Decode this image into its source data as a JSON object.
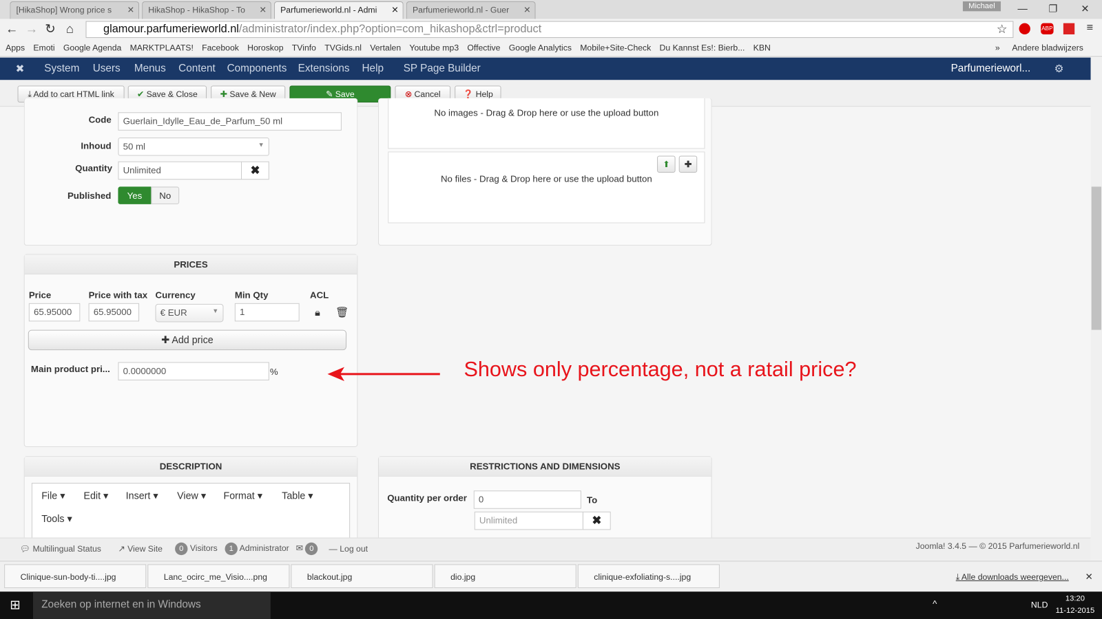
{
  "browser": {
    "tabs": [
      "[HikaShop] Wrong price s",
      "HikaShop - HikaShop - To",
      "Parfumerieworld.nl - Admi",
      "Parfumerieworld.nl - Guer"
    ],
    "user": "Michael",
    "url_domain": "glamour.parfumerieworld.nl",
    "url_path": "/administrator/index.php?option=com_hikashop&ctrl=product",
    "bookmarks": [
      "Apps",
      "Emoti",
      "Google Agenda",
      "MARKTPLAATS!",
      "Facebook",
      "Horoskop",
      "TVinfo",
      "TVGids.nl",
      "Vertalen",
      "Youtube mp3",
      "Offective",
      "Google Analytics",
      "Mobile+Site-Check",
      "Du Kannst Es!: Bierb...",
      "KBN"
    ],
    "more": "»",
    "other_bookmarks": "Andere bladwijzers"
  },
  "nav": {
    "items": [
      "System",
      "Users",
      "Menus",
      "Content",
      "Components",
      "Extensions",
      "Help",
      "SP Page Builder"
    ],
    "site": "Parfumerieworl..."
  },
  "toolbar": {
    "add_cart": "Add to cart HTML link",
    "save_close": "Save & Close",
    "save_new": "Save & New",
    "save": "Save",
    "cancel": "Cancel",
    "help": "Help",
    "save_color": "#2f8a2f"
  },
  "general": {
    "code_label": "Code",
    "code": "Guerlain_Idylle_Eau_de_Parfum_50 ml",
    "inhoud_label": "Inhoud",
    "inhoud": "50 ml",
    "qty_label": "Quantity",
    "qty": "Unlimited",
    "published_label": "Published",
    "yes": "Yes",
    "no": "No"
  },
  "media": {
    "no_images": "No images - Drag & Drop here or use the upload button",
    "no_files": "No files - Drag & Drop here or use the upload button"
  },
  "prices": {
    "title": "PRICES",
    "headers": [
      "Price",
      "Price with tax",
      "Currency",
      "Min Qty",
      "ACL"
    ],
    "price": "65.95000",
    "price_tax": "65.95000",
    "currency": "€ EUR",
    "min_qty": "1",
    "add_price": "Add price",
    "main_label": "Main product pri...",
    "main_value": "0.0000000",
    "percent": "%"
  },
  "annotation": {
    "text": "Shows only percentage, not a ratail price?",
    "color": "#e8141b"
  },
  "description": {
    "title": "DESCRIPTION",
    "menu": [
      "File",
      "Edit",
      "Insert",
      "View",
      "Format",
      "Table",
      "Tools"
    ]
  },
  "restrictions": {
    "title": "RESTRICTIONS AND DIMENSIONS",
    "qpo_label": "Quantity per order",
    "from": "0",
    "to_label": "To",
    "to": "Unlimited"
  },
  "status": {
    "multilingual": "Multilingual Status",
    "view_site": "View Site",
    "visitors_count": "0",
    "visitors": "Visitors",
    "admin_count": "1",
    "admin": "Administrator",
    "msg_count": "0",
    "logout": "Log out",
    "joomla": "Joomla! 3.4.5 — © 2015 Parfumerieworld.nl"
  },
  "downloads": {
    "files": [
      "Clinique-sun-body-ti....jpg",
      "Lanc_ocirc_me_Visio....png",
      "blackout.jpg",
      "dio.jpg",
      "clinique-exfoliating-s....jpg"
    ],
    "all": "Alle downloads weergeven..."
  },
  "taskbar": {
    "search": "Zoeken op internet en in Windows",
    "lang": "NLD",
    "time": "13:20",
    "date": "11-12-2015"
  }
}
